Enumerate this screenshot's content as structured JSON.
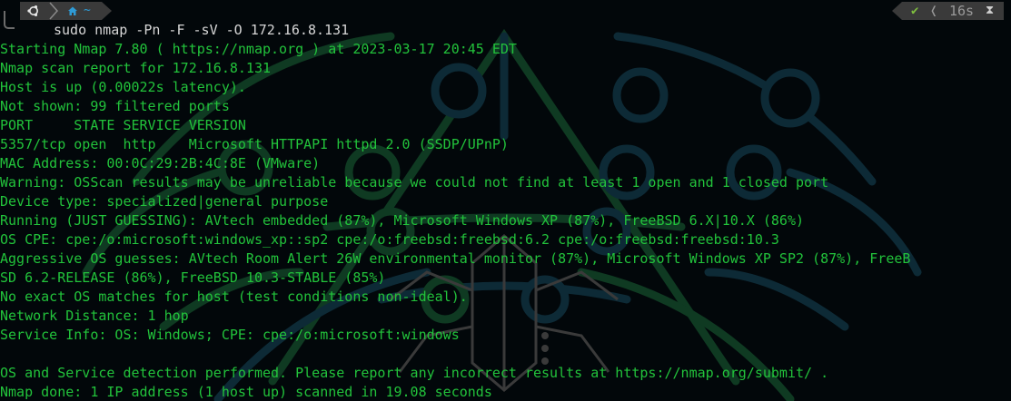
{
  "prompt": {
    "os_icon": "ubuntu-icon",
    "dir_icon": "home-icon",
    "dir_label": "~",
    "status_icon": "checkmark-icon",
    "elapsed": "16s",
    "elapsed_icon": "hourglass-icon",
    "command": "sudo nmap -Pn -F -sV -O 172.16.8.131"
  },
  "output": [
    "Starting Nmap 7.80 ( https://nmap.org ) at 2023-03-17 20:45 EDT",
    "Nmap scan report for 172.16.8.131",
    "Host is up (0.00022s latency).",
    "Not shown: 99 filtered ports",
    "PORT     STATE SERVICE VERSION",
    "5357/tcp open  http    Microsoft HTTPAPI httpd 2.0 (SSDP/UPnP)",
    "MAC Address: 00:0C:29:2B:4C:8E (VMware)",
    "Warning: OSScan results may be unreliable because we could not find at least 1 open and 1 closed port",
    "Device type: specialized|general purpose",
    "Running (JUST GUESSING): AVtech embedded (87%), Microsoft Windows XP (87%), FreeBSD 6.X|10.X (86%)",
    "OS CPE: cpe:/o:microsoft:windows_xp::sp2 cpe:/o:freebsd:freebsd:6.2 cpe:/o:freebsd:freebsd:10.3",
    "Aggressive OS guesses: AVtech Room Alert 26W environmental monitor (87%), Microsoft Windows XP SP2 (87%), FreeB",
    "SD 6.2-RELEASE (86%), FreeBSD 10.3-STABLE (85%)",
    "No exact OS matches for host (test conditions non-ideal).",
    "Network Distance: 1 hop",
    "Service Info: OS: Windows; CPE: cpe:/o:microsoft:windows",
    "",
    "OS and Service detection performed. Please report any incorrect results at https://nmap.org/submit/ .",
    "Nmap done: 1 IP address (1 host up) scanned in 19.08 seconds"
  ],
  "colors": {
    "background": "#02070a",
    "output_text": "#22c33b",
    "command_text": "#d6d6d6",
    "segment_bg": "#3a3a3a",
    "dir_accent": "#2e9bd6",
    "status_ok": "#7fbf3f",
    "wallpaper_green": "#0f3a22",
    "wallpaper_teal": "#0d2a36"
  }
}
